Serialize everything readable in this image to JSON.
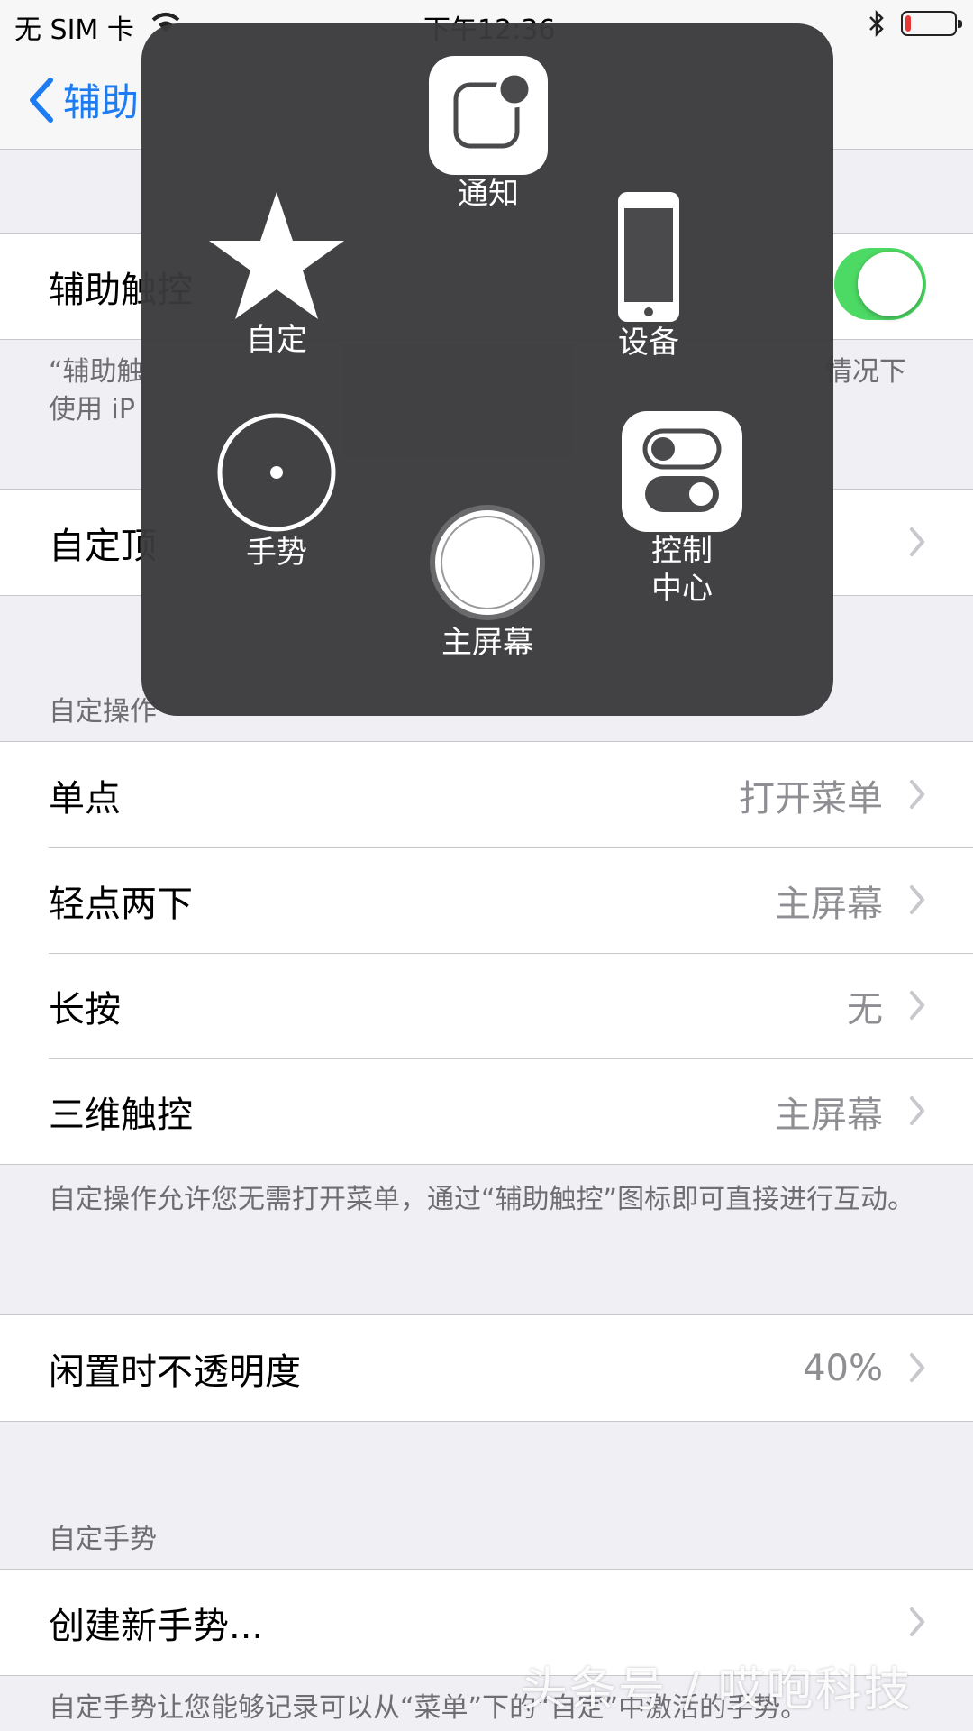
{
  "status_bar": {
    "carrier": "无 SIM 卡",
    "time": "下午12:36",
    "battery_level_fraction": 0.12,
    "colors": {
      "battery_low": "#e53935"
    }
  },
  "nav": {
    "back_label": "辅助"
  },
  "toggle_row": {
    "label": "辅助触控",
    "on": true,
    "color": "#4cd964"
  },
  "toggle_footer": {
    "left_line1": "“辅助触",
    "left_line2": "使用 iP",
    "right_fragment": "情况下"
  },
  "customize_row": {
    "label": "自定顶"
  },
  "custom_actions": {
    "header": "自定操作",
    "rows": [
      {
        "label": "单点",
        "value": "打开菜单"
      },
      {
        "label": "轻点两下",
        "value": "主屏幕"
      },
      {
        "label": "长按",
        "value": "无"
      },
      {
        "label": "三维触控",
        "value": "主屏幕"
      }
    ],
    "footer": "自定操作允许您无需打开菜单，通过“辅助触控”图标即可直接进行互动。"
  },
  "opacity_row": {
    "label": "闲置时不透明度",
    "value": "40%"
  },
  "custom_gestures": {
    "header": "自定手势",
    "row_label": "创建新手势...",
    "footer": "自定手势让您能够记录可以从“菜单”下的“自定”中激活的手势。"
  },
  "at_menu": {
    "notification": "通知",
    "custom": "自定",
    "device": "设备",
    "gesture": "手势",
    "home": "主屏幕",
    "control_center_line1": "控制",
    "control_center_line2": "中心"
  },
  "watermark": "头条号 / 哎咆科技",
  "icons": {
    "back": "chevron-left-icon",
    "chevron": "chevron-right-icon",
    "notification": "notification-center-icon",
    "custom": "star-icon",
    "device": "iphone-icon",
    "gesture": "gesture-circle-icon",
    "home": "home-button-icon",
    "control_center": "toggles-icon"
  },
  "colors": {
    "accent": "#1e7cf2",
    "toggle_on": "#4cd964",
    "secondary_text": "#8e8e93"
  }
}
